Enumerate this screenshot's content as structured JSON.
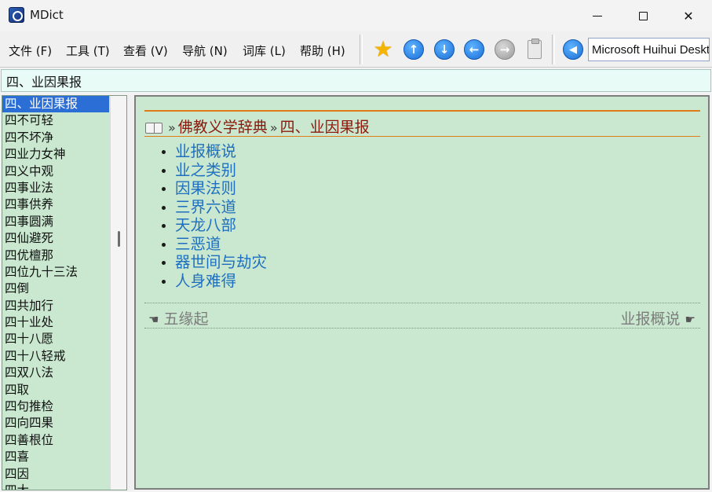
{
  "window": {
    "title": "MDict",
    "controls": {
      "minimize": "minimize",
      "maximize": "maximize",
      "close": "✕"
    }
  },
  "menu": [
    {
      "label": "文件 (F)"
    },
    {
      "label": "工具 (T)"
    },
    {
      "label": "查看 (V)"
    },
    {
      "label": "导航 (N)"
    },
    {
      "label": "词库 (L)"
    },
    {
      "label": "帮助 (H)"
    }
  ],
  "toolbar": {
    "icons": [
      "star-icon",
      "arrow-up-icon",
      "arrow-down-icon",
      "arrow-left-icon",
      "arrow-right-icon",
      "clipboard-icon",
      "speaker-icon"
    ],
    "font_value": "Microsoft Huihui Desktop"
  },
  "search": {
    "value": "四、业因果报"
  },
  "index_list": [
    "四、业因果报",
    "四不可轻",
    "四不坏净",
    "四业力女神",
    "四义中观",
    "四事业法",
    "四事供养",
    "四事圆满",
    "四仙避死",
    "四优檀那",
    "四位九十三法",
    "四倒",
    "四共加行",
    "四十业处",
    "四十八愿",
    "四十八轻戒",
    "四双八法",
    "四取",
    "四句推检",
    "四向四果",
    "四善根位",
    "四喜",
    "四因",
    "四大"
  ],
  "selected_index": 0,
  "article": {
    "breadcrumb_dictionary": "佛教义学辞典",
    "breadcrumb_separator": "»",
    "breadcrumb_entry": "四、业因果报",
    "topics": [
      "业报概说",
      "业之类别",
      "因果法则",
      "三界六道",
      "天龙八部",
      "三恶道",
      "器世间与劫灾",
      "人身难得"
    ],
    "prev_label": "五缘起",
    "next_label": "业报概说",
    "prev_hand": "☚",
    "next_hand": "☛"
  },
  "colors": {
    "pane_background": "#c9e8cf",
    "accent_rule": "#e07b1a",
    "breadcrumb_text": "#8b1a0d",
    "link_text": "#1f6fc0",
    "selection": "#2b6fd6"
  }
}
